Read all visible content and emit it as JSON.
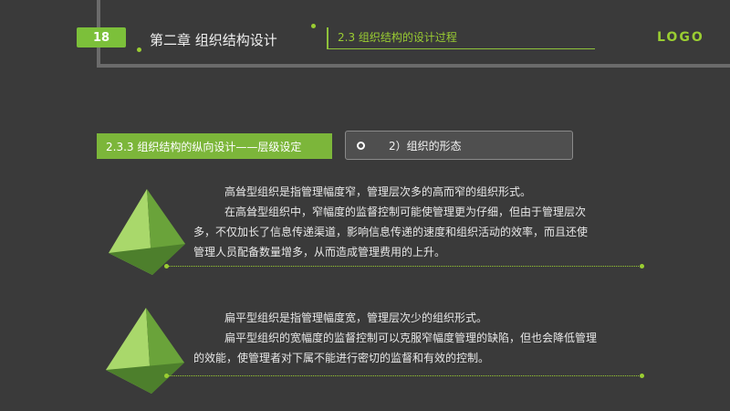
{
  "header": {
    "page_number": "18",
    "chapter_title": "第二章  组织结构设计",
    "section_label": "2.3 组织结构的设计过程",
    "logo_text": "LOGO"
  },
  "subsection": {
    "tag": "2.3.3  组织结构的纵向设计——层级设定",
    "topic": "2）组织的形态"
  },
  "paragraphs": {
    "tall": {
      "line1": "高耸型组织是指管理幅度窄，管理层次多的高而窄的组织形式。",
      "line2": "在高耸型组织中，窄幅度的监督控制可能使管理更为仔细，但由于管理层次",
      "line3": "多，不仅加长了信息传递渠道，影响信息传递的速度和组织活动的效率，而且还使",
      "line4": "管理人员配备数量增多，从而造成管理费用的上升。"
    },
    "flat": {
      "line1": "扁平型组织是指管理幅度宽，管理层次少的组织形式。",
      "line2": "扁平型组织的宽幅度的监督控制可以克服窄幅度管理的缺陷，但也会降低管理",
      "line3": "的效能，使管理者对下属不能进行密切的监督和有效的控制。"
    }
  },
  "colors": {
    "accent": "#7cc03a",
    "background": "#3a3a3a"
  }
}
